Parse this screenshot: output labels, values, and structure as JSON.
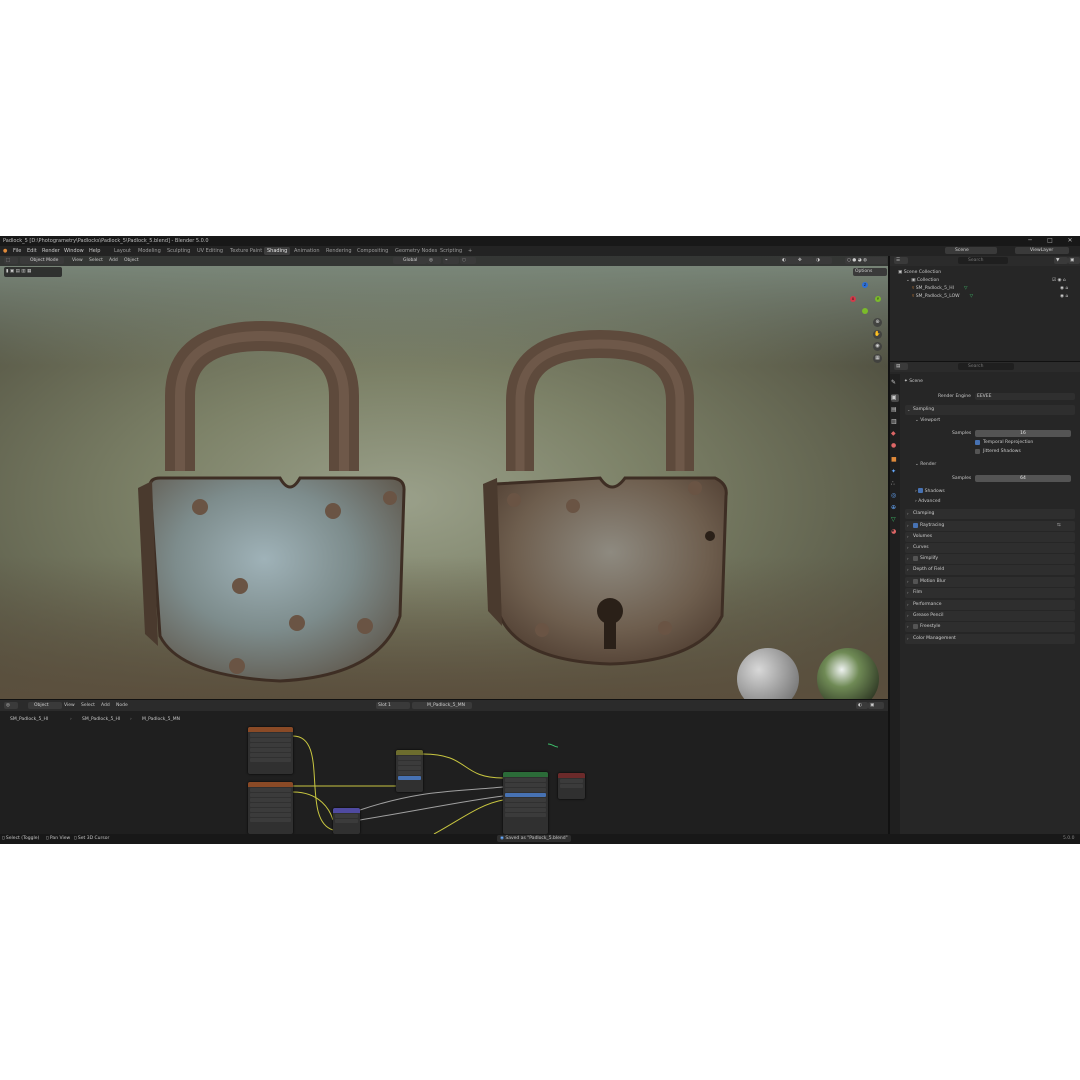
{
  "window": {
    "title": "Padlock_5 [D:\\Photogrametry\\Padlocks\\Padlock_5\\Padlock_5.blend] - Blender 5.0.0",
    "controls": [
      "─",
      "□",
      "✕"
    ]
  },
  "menu": {
    "items": [
      "File",
      "Edit",
      "Render",
      "Window",
      "Help"
    ],
    "workspaces": [
      "Layout",
      "Modeling",
      "Sculpting",
      "UV Editing",
      "Texture Paint",
      "Shading",
      "Animation",
      "Rendering",
      "Compositing",
      "Geometry Nodes",
      "Scripting"
    ],
    "active_workspace": "Shading",
    "add_tab": "+",
    "scene": "Scene",
    "view_layer": "ViewLayer"
  },
  "viewport": {
    "mode": "Object Mode",
    "menus": [
      "View",
      "Select",
      "Add",
      "Object"
    ],
    "orientation": "Global",
    "options_label": "Options",
    "axes": {
      "x": "X",
      "y": "Y",
      "z": "Z"
    },
    "nav_icons": [
      "zoom-icon",
      "hand-icon",
      "camera-icon",
      "grid-icon"
    ]
  },
  "node_editor": {
    "object_type": "Object",
    "menus": [
      "View",
      "Select",
      "Add",
      "Node"
    ],
    "slot": "Slot 1",
    "material": "M_Padlock_5_MN",
    "breadcrumb": [
      "SM_Padlock_5_HI",
      "SM_Padlock_5_HI",
      "M_Padlock_5_MN"
    ]
  },
  "outliner": {
    "search_placeholder": "Search",
    "root": "Scene Collection",
    "collection": "Collection",
    "objects": [
      "SM_Padlock_5_HI",
      "SM_Padlock_5_LOW"
    ]
  },
  "properties": {
    "search_placeholder": "Search",
    "context": "Scene",
    "render_engine_label": "Render Engine",
    "render_engine": "EEVEE",
    "sampling": "Sampling",
    "viewport": "Viewport",
    "samples_label": "Samples",
    "viewport_samples": "16",
    "temporal_reprojection": "Temporal Reprojection",
    "jittered_shadows": "Jittered Shadows",
    "render": "Render",
    "render_samples": "64",
    "shadows": "Shadows",
    "advanced": "Advanced",
    "panels": [
      "Clamping",
      "Raytracing",
      "Volumes",
      "Curves",
      "Simplify",
      "Depth of Field",
      "Motion Blur",
      "Film",
      "Performance",
      "Grease Pencil",
      "Freestyle",
      "Color Management"
    ]
  },
  "status": {
    "left": [
      "Select (Toggle)",
      "Pan View",
      "Set 3D Cursor"
    ],
    "message": "Saved as \"Padlock_5.blend\"",
    "version": "5.0.0"
  },
  "colors": {
    "accent": "#4772b3",
    "active_workspace": "#3d3d3d",
    "node_texture": "#8a4a26",
    "node_shader": "#2b6b38",
    "node_output": "#6b2a2a",
    "node_vector": "#4f4aa0",
    "wire_yellow": "#c8c640"
  }
}
